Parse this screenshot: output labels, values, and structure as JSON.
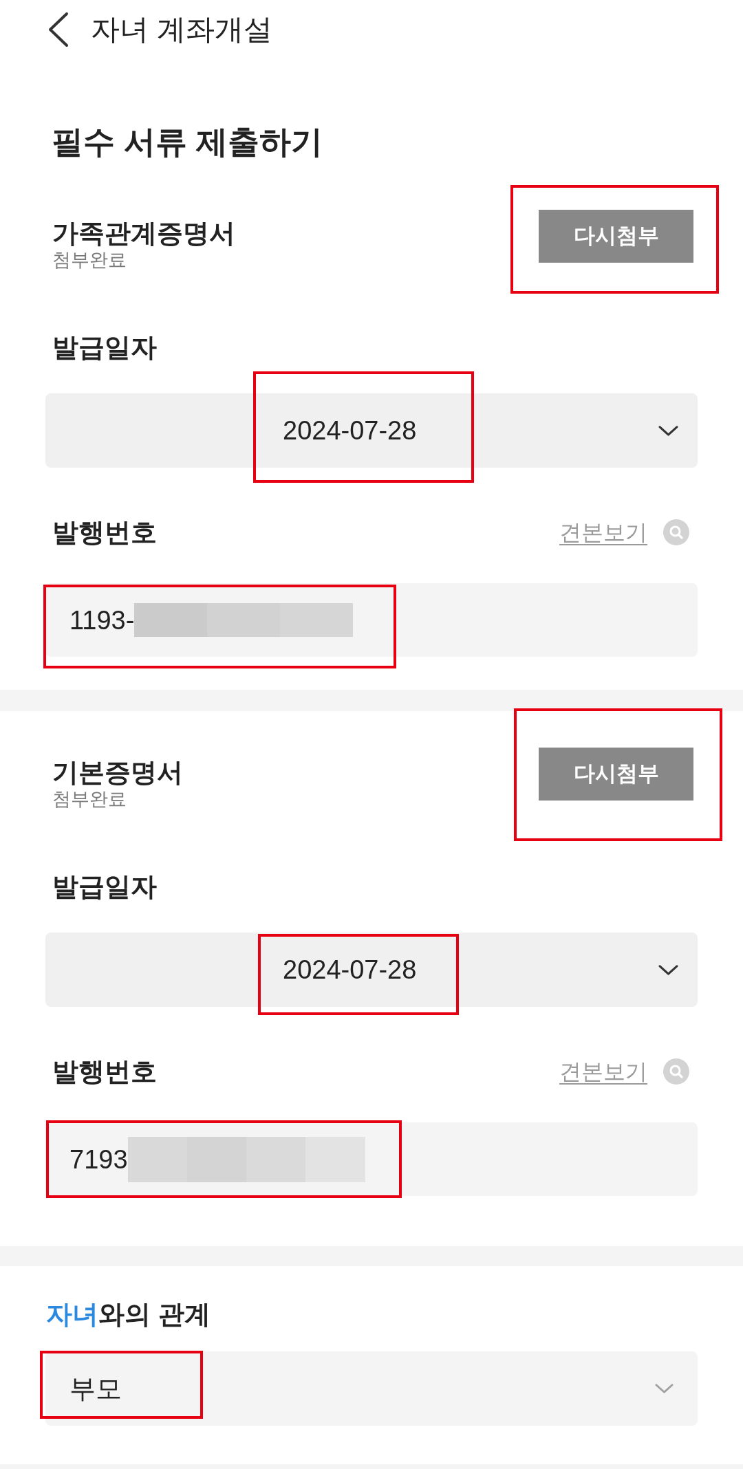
{
  "header": {
    "title": "자녀 계좌개설"
  },
  "page_title": "필수 서류 제출하기",
  "documents": [
    {
      "name": "가족관계증명서",
      "status": "첨부완료",
      "reattach_button": {
        "label": "다시첨부",
        "highlighted": true
      },
      "issue_date": {
        "label": "발급일자",
        "value": "2024-07-28",
        "highlighted": true
      },
      "issue_number": {
        "label": "발행번호",
        "sample_link": "견본보기",
        "value": "1193-",
        "redacted": true,
        "highlighted": true
      }
    },
    {
      "name": "기본증명서",
      "status": "첨부완료",
      "reattach_button": {
        "label": "다시첨부",
        "highlighted": true
      },
      "issue_date": {
        "label": "발급일자",
        "value": "2024-07-28",
        "highlighted": true
      },
      "issue_number": {
        "label": "발행번호",
        "sample_link": "견본보기",
        "value": "7193",
        "redacted": true,
        "highlighted": true
      }
    }
  ],
  "relationship": {
    "label": [
      {
        "text": "자녀",
        "accent": true
      },
      {
        "text": "와의 관계",
        "accent": false
      }
    ],
    "value": "부모",
    "highlighted": true
  }
}
